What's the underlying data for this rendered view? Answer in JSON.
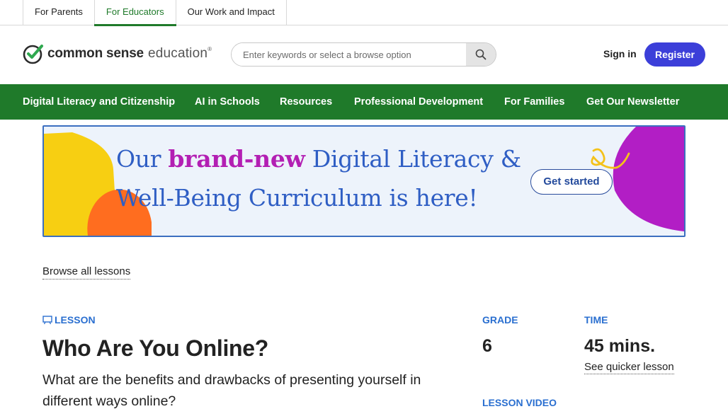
{
  "top_tabs": [
    {
      "label": "For Parents",
      "active": false
    },
    {
      "label": "For Educators",
      "active": true
    },
    {
      "label": "Our Work and Impact",
      "active": false
    }
  ],
  "logo": {
    "word1": "common sense",
    "word2": "education",
    "mark": "®"
  },
  "search": {
    "placeholder": "Enter keywords or select a browse option",
    "icon": "search-icon"
  },
  "auth": {
    "signin": "Sign in",
    "register": "Register"
  },
  "main_nav": [
    {
      "label": "Digital Literacy and Citizenship"
    },
    {
      "label": "AI in Schools"
    },
    {
      "label": "Resources"
    },
    {
      "label": "Professional Development"
    },
    {
      "label": "For Families"
    },
    {
      "label": "Get Our Newsletter"
    }
  ],
  "banner": {
    "part1": "Our ",
    "highlight": "brand-new",
    "part2": " Digital Literacy & Well-Being Curriculum is here!",
    "cta": "Get started"
  },
  "browse_link": "Browse all lessons",
  "lesson": {
    "tag": "LESSON",
    "title": "Who Are You Online?",
    "subtitle": "What are the benefits and drawbacks of presenting yourself in different ways online?",
    "grade_label": "GRADE",
    "grade_value": "6",
    "time_label": "TIME",
    "time_value": "45 mins.",
    "quicker_link": "See quicker lesson",
    "video_label": "LESSON VIDEO"
  },
  "colors": {
    "brand_green": "#1f7a2a",
    "register_blue": "#3c3fd9",
    "accent_blue": "#2a6fd0",
    "banner_text": "#2f5ec4",
    "banner_highlight": "#b31fb3"
  }
}
